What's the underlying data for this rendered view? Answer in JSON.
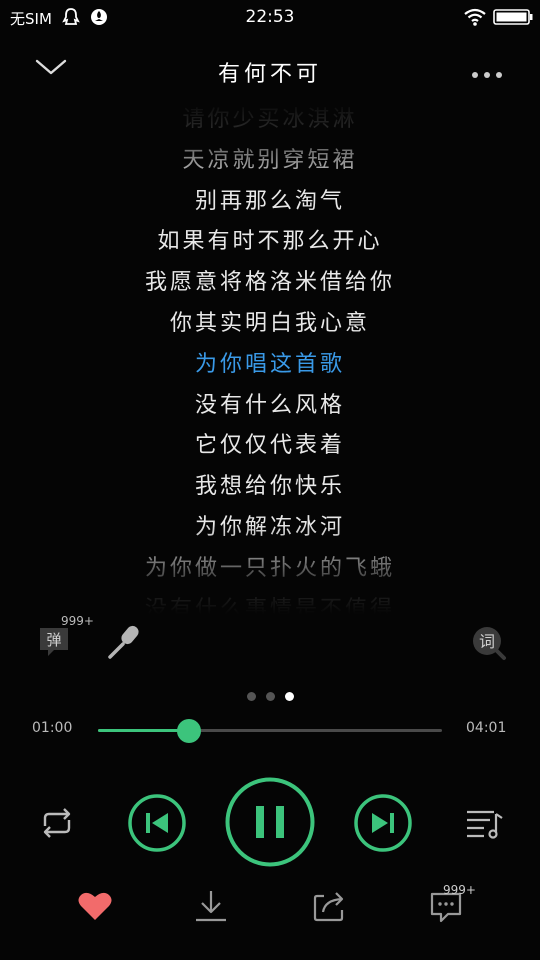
{
  "status_bar": {
    "carrier": "无SIM",
    "time": "22:53"
  },
  "header": {
    "title": "有何不可"
  },
  "lyrics": [
    {
      "text": "请你少买冰淇淋",
      "state": "faded"
    },
    {
      "text": "天凉就别穿短裙",
      "state": "normal"
    },
    {
      "text": "别再那么淘气",
      "state": "normal"
    },
    {
      "text": "如果有时不那么开心",
      "state": "normal"
    },
    {
      "text": "我愿意将格洛米借给你",
      "state": "normal"
    },
    {
      "text": "你其实明白我心意",
      "state": "normal"
    },
    {
      "text": "为你唱这首歌",
      "state": "active"
    },
    {
      "text": "没有什么风格",
      "state": "normal"
    },
    {
      "text": "它仅仅代表着",
      "state": "normal"
    },
    {
      "text": "我想给你快乐",
      "state": "normal"
    },
    {
      "text": "为你解冻冰河",
      "state": "normal"
    },
    {
      "text": "为你做一只扑火的飞蛾",
      "state": "normal"
    },
    {
      "text": "没有什么事情是不值得",
      "state": "faded"
    }
  ],
  "tools": {
    "danmaku_label": "弹",
    "danmaku_badge": "999+",
    "lyrics_label": "词"
  },
  "pager": {
    "count": 3,
    "active_index": 2
  },
  "progress": {
    "current": "01:00",
    "total": "04:01",
    "fraction": 0.2656
  },
  "bottom_bar": {
    "comment_badge": "999+"
  },
  "colors": {
    "accent_green": "#3cc47c",
    "active_lyric": "#3a9ae8",
    "heart": "#f26b6b"
  }
}
